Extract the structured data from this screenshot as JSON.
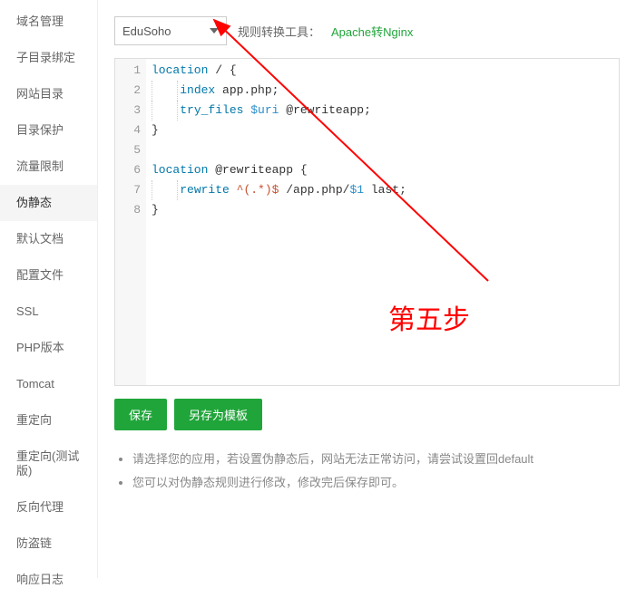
{
  "sidebar": {
    "items": [
      {
        "label": "域名管理"
      },
      {
        "label": "子目录绑定"
      },
      {
        "label": "网站目录"
      },
      {
        "label": "目录保护"
      },
      {
        "label": "流量限制"
      },
      {
        "label": "伪静态"
      },
      {
        "label": "默认文档"
      },
      {
        "label": "配置文件"
      },
      {
        "label": "SSL"
      },
      {
        "label": "PHP版本"
      },
      {
        "label": "Tomcat"
      },
      {
        "label": "重定向"
      },
      {
        "label": "重定向(测试版)"
      },
      {
        "label": "反向代理"
      },
      {
        "label": "防盗链"
      },
      {
        "label": "响应日志"
      }
    ],
    "activeIndex": 5
  },
  "toolbar": {
    "select_value": "EduSoho",
    "convert_label": "规则转换工具：",
    "convert_link": "Apache转Nginx"
  },
  "code": {
    "lines": [
      [
        {
          "t": "location",
          "c": "kw"
        },
        {
          "t": " / {",
          "c": ""
        }
      ],
      [
        {
          "t": "    ",
          "c": ""
        },
        {
          "t": "index",
          "c": "kw"
        },
        {
          "t": " app.php;",
          "c": ""
        }
      ],
      [
        {
          "t": "    ",
          "c": ""
        },
        {
          "t": "try_files",
          "c": "kw"
        },
        {
          "t": " ",
          "c": ""
        },
        {
          "t": "$uri",
          "c": "var"
        },
        {
          "t": " @rewriteapp;",
          "c": ""
        }
      ],
      [
        {
          "t": "}",
          "c": ""
        }
      ],
      [
        {
          "t": "",
          "c": ""
        }
      ],
      [
        {
          "t": "location",
          "c": "kw"
        },
        {
          "t": " @rewriteapp {",
          "c": ""
        }
      ],
      [
        {
          "t": "    ",
          "c": ""
        },
        {
          "t": "rewrite",
          "c": "kw"
        },
        {
          "t": " ",
          "c": ""
        },
        {
          "t": "^(.*)$",
          "c": "regex"
        },
        {
          "t": " /app.php/",
          "c": ""
        },
        {
          "t": "$1",
          "c": "var"
        },
        {
          "t": " last;",
          "c": ""
        }
      ],
      [
        {
          "t": "}",
          "c": ""
        }
      ]
    ]
  },
  "buttons": {
    "save": "保存",
    "save_as": "另存为模板"
  },
  "tips": [
    "请选择您的应用，若设置伪静态后，网站无法正常访问，请尝试设置回default",
    "您可以对伪静态规则进行修改，修改完后保存即可。"
  ],
  "annotation": {
    "step_label": "第五步"
  }
}
